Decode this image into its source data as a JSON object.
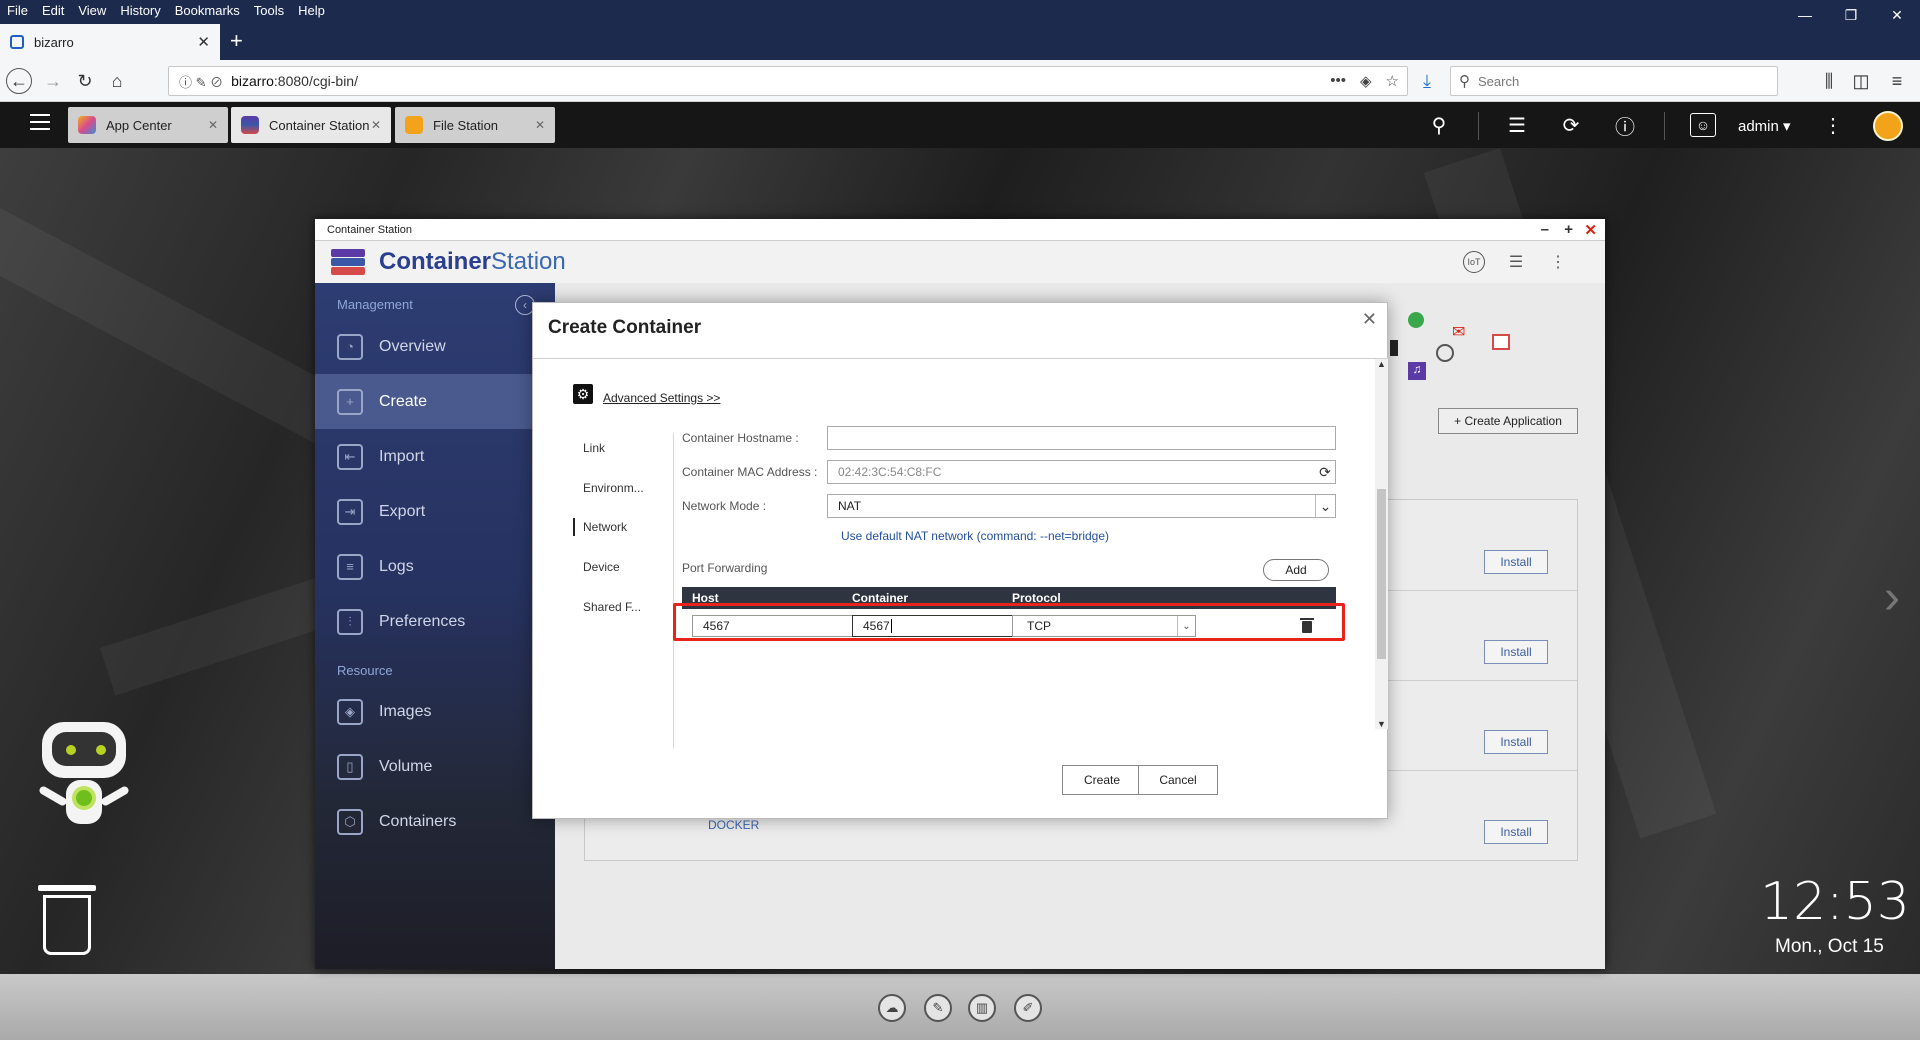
{
  "browser": {
    "menu": [
      "File",
      "Edit",
      "View",
      "History",
      "Bookmarks",
      "Tools",
      "Help"
    ],
    "tab_title": "bizarro",
    "url_host": "bizarro",
    "url_path": ":8080/cgi-bin/",
    "search_placeholder": "Search"
  },
  "qts": {
    "tabs": [
      {
        "label": "App Center",
        "color": "#d94b8c"
      },
      {
        "label": "Container Station",
        "color": "#3b57a8"
      },
      {
        "label": "File Station",
        "color": "#f2a31a"
      }
    ],
    "user": "admin ▾",
    "clock": "12:53",
    "date": "Mon., Oct 15"
  },
  "cs": {
    "window_title": "Container Station",
    "logo_bold": "Container",
    "logo_light": "Station",
    "sidebar": {
      "management_label": "Management",
      "resource_label": "Resource",
      "items": [
        "Overview",
        "Create",
        "Import",
        "Export",
        "Logs",
        "Preferences"
      ],
      "resource_items": [
        "Images",
        "Volume",
        "Containers"
      ]
    },
    "create_app_label": "+ Create Application",
    "install_label": "Install",
    "docker_label": "DOCKER"
  },
  "modal": {
    "title": "Create Container",
    "advanced_link": "Advanced Settings >>",
    "nav": [
      "Link",
      "Environm...",
      "Network",
      "Device",
      "Shared F..."
    ],
    "active_nav": "Network",
    "hostname_label": "Container Hostname :",
    "hostname_value": "",
    "mac_label": "Container MAC Address :",
    "mac_value": "02:42:3C:54:C8:FC",
    "netmode_label": "Network Mode :",
    "netmode_value": "NAT",
    "nat_hint": "Use default NAT network (command: --net=bridge)",
    "port_forwarding_label": "Port Forwarding",
    "add_label": "Add",
    "columns": [
      "Host",
      "Container",
      "Protocol"
    ],
    "row": {
      "host": "4567",
      "container": "4567",
      "protocol": "TCP"
    },
    "create_label": "Create",
    "cancel_label": "Cancel"
  }
}
